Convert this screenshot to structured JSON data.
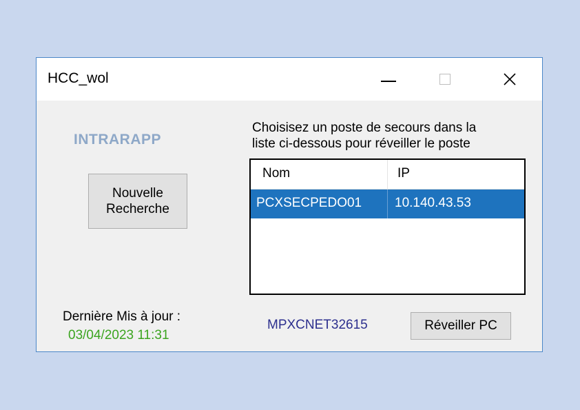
{
  "window": {
    "title": "HCC_wol",
    "controls": {
      "minimize": "minimize-icon",
      "maximize": "maximize-icon",
      "close": "close-icon",
      "close_glyph": "✕"
    }
  },
  "left_panel": {
    "brand": "INTRARAPP",
    "new_search_label": "Nouvelle\nRecherche",
    "last_update_label": "Dernière Mis à jour :",
    "last_update_value": "03/04/2023 11:31"
  },
  "main": {
    "instructions": "Choisisez un poste de secours dans la\nliste ci-dessous pour réveiller le poste",
    "list": {
      "columns": [
        "Nom",
        "IP"
      ],
      "rows": [
        {
          "nom": "PCXSECPEDO01",
          "ip": "10.140.43.53",
          "selected": true
        }
      ]
    },
    "hostname": "MPXCNET32615",
    "wake_button_label": "Réveiller PC"
  },
  "colors": {
    "background": "#c9d7ee",
    "window_border": "#4a86c8",
    "selection": "#1e73be",
    "brand": "#8ea8c8",
    "update_date": "#3ba41f",
    "hostname": "#2c2f8e"
  }
}
